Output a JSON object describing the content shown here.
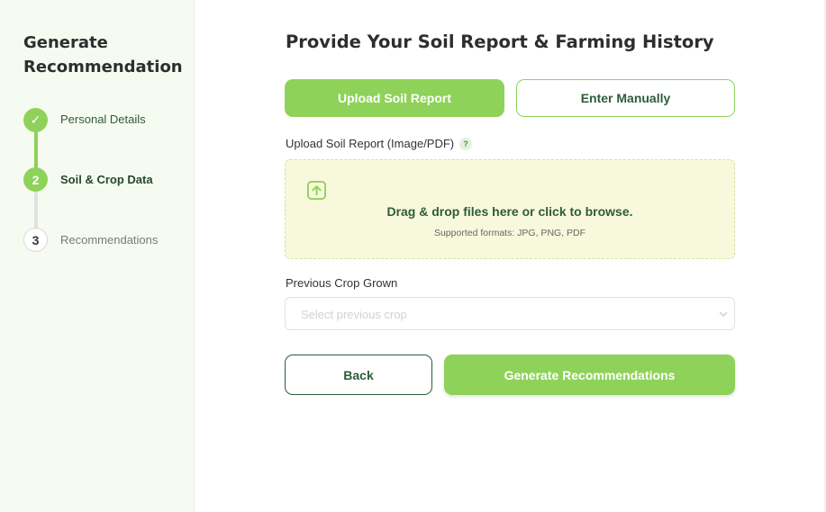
{
  "sidebar": {
    "title": "Generate Recommendation",
    "steps": [
      {
        "number": "✓",
        "label": "Personal Details",
        "state": "complete"
      },
      {
        "number": "2",
        "label": "Soil & Crop Data",
        "state": "active"
      },
      {
        "number": "3",
        "label": "Recommendations",
        "state": "upcoming"
      }
    ]
  },
  "main": {
    "heading": "Provide Your Soil Report & Farming History",
    "tabs": {
      "upload_label": "Upload Soil Report",
      "manual_label": "Enter Manually"
    },
    "upload": {
      "label": "Upload Soil Report (Image/PDF)",
      "help_icon": "?",
      "drop_text": "Drag & drop files here or click to browse.",
      "formats_text": "Supported formats: JPG, PNG, PDF"
    },
    "previous_crop": {
      "label": "Previous Crop Grown",
      "placeholder": "Select previous crop"
    },
    "actions": {
      "back_label": "Back",
      "generate_label": "Generate Recommendations"
    }
  },
  "colors": {
    "accent": "#8fd25a",
    "dark_green": "#2e5b3a",
    "sidebar_bg": "#f6fbf2",
    "dropzone_bg": "#f8f9dc"
  }
}
